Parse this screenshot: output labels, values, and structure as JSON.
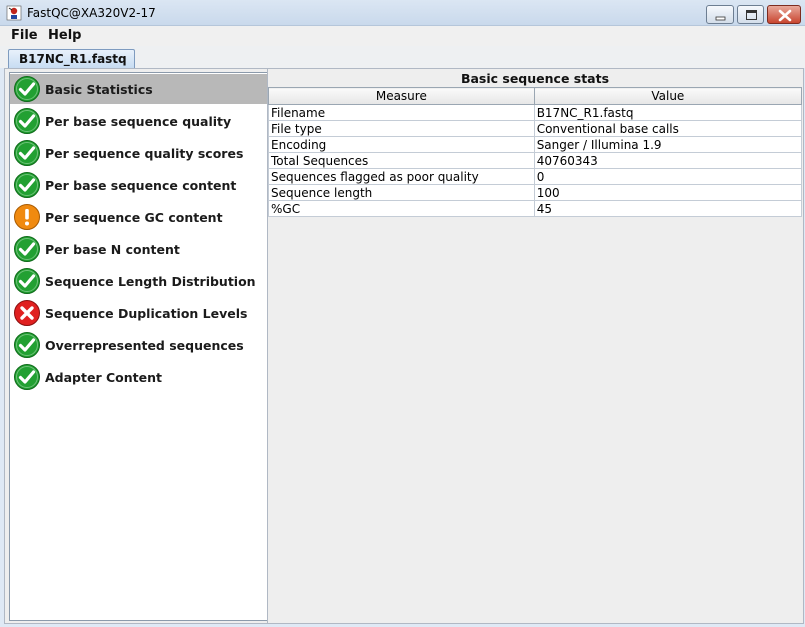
{
  "window": {
    "title": "FastQC@XA320V2-17"
  },
  "menu": {
    "file": "File",
    "help": "Help"
  },
  "tab": {
    "label": "B17NC_R1.fastq"
  },
  "modules": [
    {
      "label": "Basic Statistics",
      "status": "pass",
      "selected": true
    },
    {
      "label": "Per base sequence quality",
      "status": "pass"
    },
    {
      "label": "Per sequence quality scores",
      "status": "pass"
    },
    {
      "label": "Per base sequence content",
      "status": "pass"
    },
    {
      "label": "Per sequence GC content",
      "status": "warn"
    },
    {
      "label": "Per base N content",
      "status": "pass"
    },
    {
      "label": "Sequence Length Distribution",
      "status": "pass"
    },
    {
      "label": "Sequence Duplication Levels",
      "status": "fail"
    },
    {
      "label": "Overrepresented sequences",
      "status": "pass"
    },
    {
      "label": "Adapter Content",
      "status": "pass"
    }
  ],
  "stats": {
    "title": "Basic sequence stats",
    "columns": [
      "Measure",
      "Value"
    ],
    "rows": [
      [
        "Filename",
        "B17NC_R1.fastq"
      ],
      [
        "File type",
        "Conventional base calls"
      ],
      [
        "Encoding",
        "Sanger / Illumina 1.9"
      ],
      [
        "Total Sequences",
        "40760343"
      ],
      [
        "Sequences flagged as poor quality",
        "0"
      ],
      [
        "Sequence length",
        "100"
      ],
      [
        "%GC",
        "45"
      ]
    ]
  },
  "colors": {
    "pass": "#22a032",
    "warn": "#f08a10",
    "fail": "#e02020",
    "selected": "#b8b8b8"
  },
  "icons": {
    "pass": "check-circle-icon",
    "warn": "exclamation-circle-icon",
    "fail": "cross-circle-icon"
  }
}
